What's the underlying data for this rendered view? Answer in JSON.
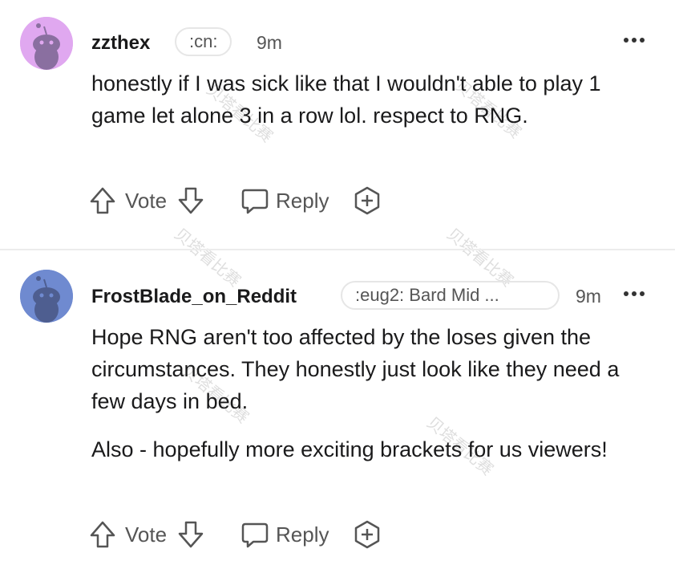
{
  "comments": [
    {
      "username": "zzthex",
      "flair": ":cn:",
      "time": "9m",
      "avatar_color": "#e0a8f0",
      "body": [
        "honestly if I was sick like that I wouldn't able to play 1 game let alone 3 in a row lol. respect to RNG."
      ],
      "actions": {
        "vote": "Vote",
        "reply": "Reply"
      }
    },
    {
      "username": "FrostBlade_on_Reddit",
      "flair": ":eug2: Bard Mid ...",
      "time": "9m",
      "avatar_color": "#6f8ad0",
      "body": [
        "Hope RNG aren't too affected by the loses given the circumstances. They honestly just look like they need a few days in bed.",
        "Also - hopefully more exciting brackets for us viewers!"
      ],
      "actions": {
        "vote": "Vote",
        "reply": "Reply"
      }
    }
  ],
  "watermark": "贝塔看比赛",
  "icons": {
    "more": "more-options-icon",
    "upvote": "upvote-arrow-icon",
    "downvote": "downvote-arrow-icon",
    "reply": "reply-bubble-icon",
    "award": "award-plus-icon"
  }
}
